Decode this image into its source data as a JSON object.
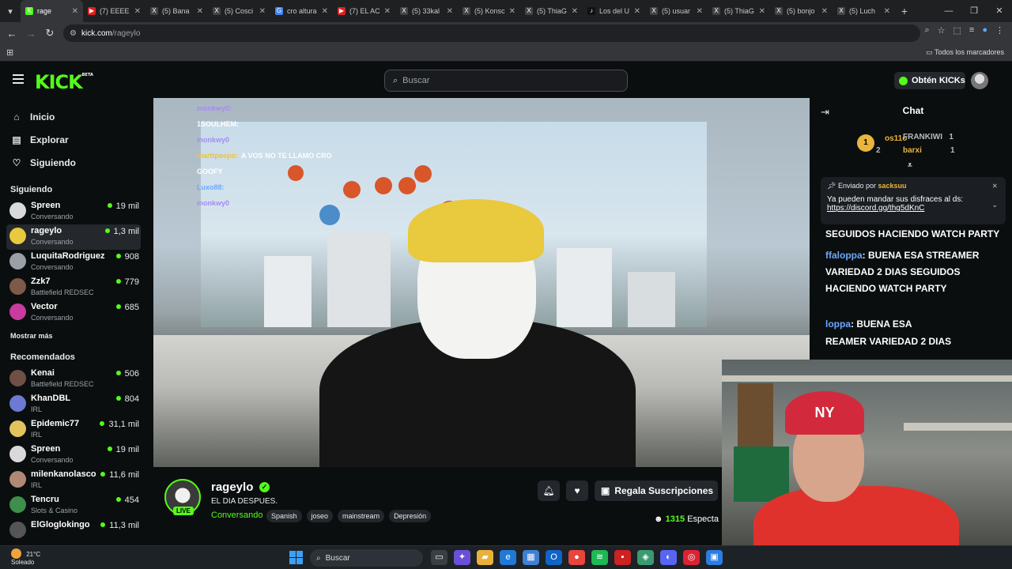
{
  "browser": {
    "tabs": [
      {
        "title": "rage",
        "active": true,
        "color": "#53fc18",
        "glyph": "K"
      },
      {
        "title": "(7) EEEE",
        "active": false,
        "color": "#e02020",
        "glyph": "▶"
      },
      {
        "title": "(5) Bana",
        "active": false,
        "color": "#444444",
        "glyph": "X"
      },
      {
        "title": "(5) Cosci",
        "active": false,
        "color": "#444444",
        "glyph": "X"
      },
      {
        "title": "cro altura",
        "active": false,
        "color": "#4285f4",
        "glyph": "G"
      },
      {
        "title": "(7) EL AC",
        "active": false,
        "color": "#e02020",
        "glyph": "▶"
      },
      {
        "title": "(5) 33kal",
        "active": false,
        "color": "#444444",
        "glyph": "X"
      },
      {
        "title": "(5) Konsc",
        "active": false,
        "color": "#444444",
        "glyph": "X"
      },
      {
        "title": "(5) ThiaG",
        "active": false,
        "color": "#444444",
        "glyph": "X"
      },
      {
        "title": "Los del U",
        "active": false,
        "color": "#111111",
        "glyph": "♪"
      },
      {
        "title": "(5) usuar",
        "active": false,
        "color": "#444444",
        "glyph": "X"
      },
      {
        "title": "(5) ThiaG",
        "active": false,
        "color": "#444444",
        "glyph": "X"
      },
      {
        "title": "(5) bonjo",
        "active": false,
        "color": "#444444",
        "glyph": "X"
      },
      {
        "title": "(5) Luch",
        "active": false,
        "color": "#444444",
        "glyph": "X"
      }
    ],
    "url_site": "kick.com",
    "url_path": "/rageylo",
    "bookmarks_all": "Todos los marcadores"
  },
  "header": {
    "logo": "KICK",
    "logo_badge": "BETA",
    "search_placeholder": "Buscar",
    "kicks_button": "Obtén KICKs"
  },
  "sidebar": {
    "nav": [
      {
        "label": "Inicio",
        "icon": "⌂",
        "name": "home-icon"
      },
      {
        "label": "Explorar",
        "icon": "▤",
        "name": "compass-icon"
      },
      {
        "label": "Siguiendo",
        "icon": "♡",
        "name": "heart-icon"
      }
    ],
    "following_title": "Siguiendo",
    "following": [
      {
        "name": "Spreen",
        "category": "Conversando",
        "viewers": "19 mil",
        "avatar": "#d9d9d9"
      },
      {
        "name": "rageylo",
        "category": "Conversando",
        "viewers": "1,3 mil",
        "avatar": "#e9c93d"
      },
      {
        "name": "LuquitaRodriguez",
        "category": "Conversando",
        "viewers": "908",
        "avatar": "#9aa0a6"
      },
      {
        "name": "Zzk7",
        "category": "Battlefield REDSEC",
        "viewers": "779",
        "avatar": "#7d5a49"
      },
      {
        "name": "Vector",
        "category": "Conversando",
        "viewers": "685",
        "avatar": "#c83b9f"
      }
    ],
    "show_more": "Mostrar más",
    "recommended_title": "Recomendados",
    "recommended": [
      {
        "name": "Kenai",
        "category": "Battlefield REDSEC",
        "viewers": "506",
        "avatar": "#6e5047"
      },
      {
        "name": "KhanDBL",
        "category": "IRL",
        "viewers": "804",
        "avatar": "#6c7ad1"
      },
      {
        "name": "Epidemic77",
        "category": "IRL",
        "viewers": "31,1 mil",
        "avatar": "#e3c35d"
      },
      {
        "name": "Spreen",
        "category": "Conversando",
        "viewers": "19 mil",
        "avatar": "#d9d9d9"
      },
      {
        "name": "milenkanolasco",
        "category": "IRL",
        "viewers": "11,6 mil",
        "avatar": "#b08975"
      },
      {
        "name": "Tencru",
        "category": "Slots & Casino",
        "viewers": "454",
        "avatar": "#3d8f4b"
      },
      {
        "name": "ElGloglokingo",
        "category": "",
        "viewers": "11,3 mil",
        "avatar": "#555555"
      }
    ]
  },
  "video": {
    "overlay_chat": [
      {
        "user": "monkwy0:",
        "text": "",
        "color": "#a48cf0"
      },
      {
        "user": "1SOULHEM:",
        "text": "",
        "color": "#ffffff"
      },
      {
        "user": "monkwy0",
        "text": "",
        "color": "#a48cf0"
      },
      {
        "user": "marttpeepo:",
        "text": "A VOS NO TE LLAMO CRO",
        "color": "#f0c23a"
      },
      {
        "user": "GOOFY",
        "text": "",
        "color": "#ffffff"
      },
      {
        "user": "Luxo88:",
        "text": "",
        "color": "#6aa8ff"
      },
      {
        "user": "monkwy0",
        "text": "",
        "color": "#a48cf0"
      }
    ]
  },
  "channel": {
    "name": "rageylo",
    "title": "EL DIA DESPUES.",
    "category": "Conversando",
    "live_label": "LIVE",
    "tags": [
      "Spanish",
      "joseo",
      "mainstream",
      "Depresión"
    ],
    "gift_button": "Regala Suscripciones",
    "viewers_count": "1315",
    "viewers_label": "Especta"
  },
  "chat": {
    "title": "Chat",
    "leaderboard": [
      {
        "rank": "1",
        "user": "os11o",
        "count": ""
      },
      {
        "rank": "2",
        "user": "",
        "count": "2"
      },
      {
        "rank": "",
        "user": "FRANKIWI",
        "count": "1"
      },
      {
        "rank": "",
        "user": "barxi",
        "count": "1"
      }
    ],
    "pinned_prefix": "Enviado por",
    "pinned_user": "sacksuu",
    "pinned_message": "Ya pueden mandar sus disfraces al ds:",
    "pinned_link": "https://discord.gg/thg5dKnC",
    "messages": [
      {
        "user": "",
        "text": "SEGUIDOS HACIENDO WATCH PARTY"
      },
      {
        "user": "ffaloppa",
        "text": ": BUENA ESA STREAMER VARIEDAD 2 DIAS SEGUIDOS HACIENDO WATCH PARTY"
      },
      {
        "user": "loppa",
        "text": ": BUENA ESA"
      },
      {
        "user": "",
        "text": "REAMER VARIEDAD 2 DIAS"
      }
    ]
  },
  "taskbar": {
    "temp": "21°C",
    "weather": "Soleado",
    "search": "Buscar"
  }
}
